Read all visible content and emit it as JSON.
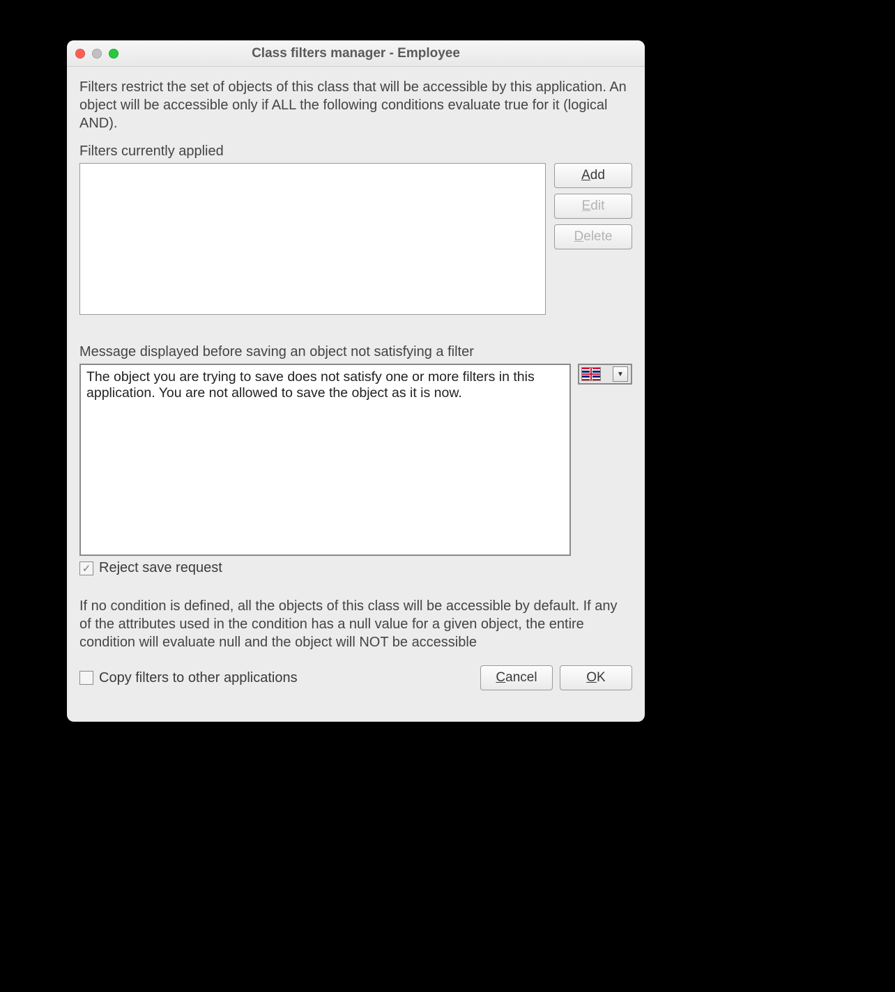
{
  "title": "Class filters manager - Employee",
  "description": "Filters restrict the set of objects of this class that will be accessible by this application. An object will be accessible only if ALL the following conditions evaluate true for it (logical AND).",
  "filters_label": "Filters currently applied",
  "filters_items": [],
  "buttons": {
    "add": "Add",
    "edit": "Edit",
    "delete": "Delete",
    "cancel": "Cancel",
    "ok": "OK"
  },
  "message_label": "Message displayed before saving an object not satisfying a filter",
  "message_value": "The object you are trying to save does not satisfy one or more filters in this application. You are not allowed to save the object as it is now.",
  "locale": "en-GB",
  "reject_checkbox": {
    "label": "Reject save request",
    "checked": true
  },
  "footer_description": "If no condition is defined, all the objects of this class will be accessible by default. If any of the attributes used in the condition has a null value for a given object, the entire condition will evaluate null and the object will NOT be accessible",
  "copy_checkbox": {
    "label": "Copy filters to other applications",
    "checked": false
  }
}
